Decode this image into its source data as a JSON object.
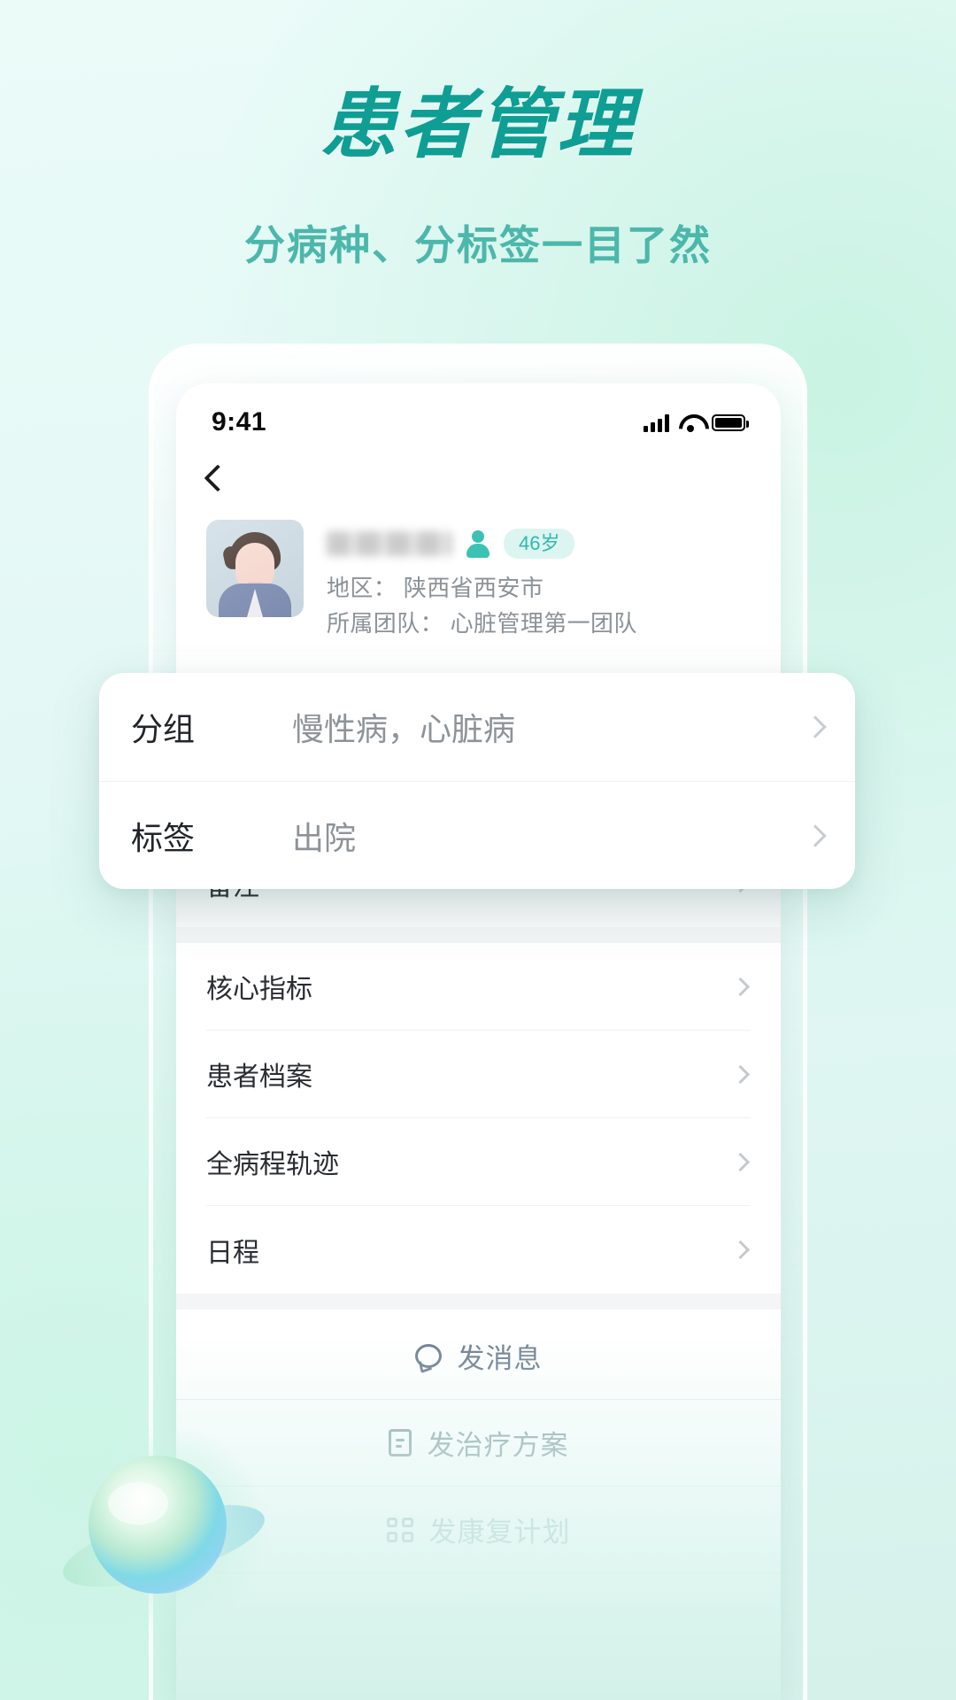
{
  "hero": {
    "title": "患者管理",
    "subtitle": "分病种、分标签一目了然",
    "title_color": "#0f9e94",
    "subtitle_color": "#4cb7ab"
  },
  "phone": {
    "statusbar": {
      "time": "9:41",
      "signal_icon": "cellular-signal-icon",
      "wifi_icon": "wifi-icon",
      "battery_icon": "battery-icon"
    },
    "navbar": {
      "back_icon": "back-chevron-icon"
    },
    "patient": {
      "avatar_icon": "patient-avatar",
      "name": "",
      "name_masked": true,
      "sex_icon": "male-person-icon",
      "age_badge": "46岁",
      "region_label": "地区：",
      "region_value": "陕西省西安市",
      "team_label": "所属团队：",
      "team_value": "心脏管理第一团队",
      "region_line": "地区： 陕西省西安市",
      "team_line": "所属团队： 心脏管理第一团队"
    },
    "detail_rows": [
      {
        "label": "分组",
        "value": "慢性病，心脏病"
      },
      {
        "label": "标签",
        "value": "出院"
      },
      {
        "label": "备注",
        "value": ""
      }
    ],
    "menu_items": [
      {
        "label": "核心指标"
      },
      {
        "label": "患者档案"
      },
      {
        "label": "全病程轨迹"
      },
      {
        "label": "日程"
      }
    ],
    "actions": [
      {
        "label": "发消息",
        "icon": "chat-bubble-icon"
      },
      {
        "label": "发治疗方案",
        "icon": "document-icon"
      },
      {
        "label": "发康复计划",
        "icon": "grid-icon"
      }
    ]
  },
  "overlay_card": {
    "rows": [
      {
        "label": "分组",
        "value": "慢性病，心脏病",
        "chevron": "chevron-right-icon"
      },
      {
        "label": "标签",
        "value": "出院",
        "chevron": "chevron-right-icon"
      }
    ]
  },
  "decor": {
    "sphere_icon": "gradient-sphere-decoration",
    "accent_color": "#0f9e94",
    "badge_bg": "#dcf5f1",
    "badge_text": "#32b8ab",
    "page_bg": "#e3f8f6"
  }
}
